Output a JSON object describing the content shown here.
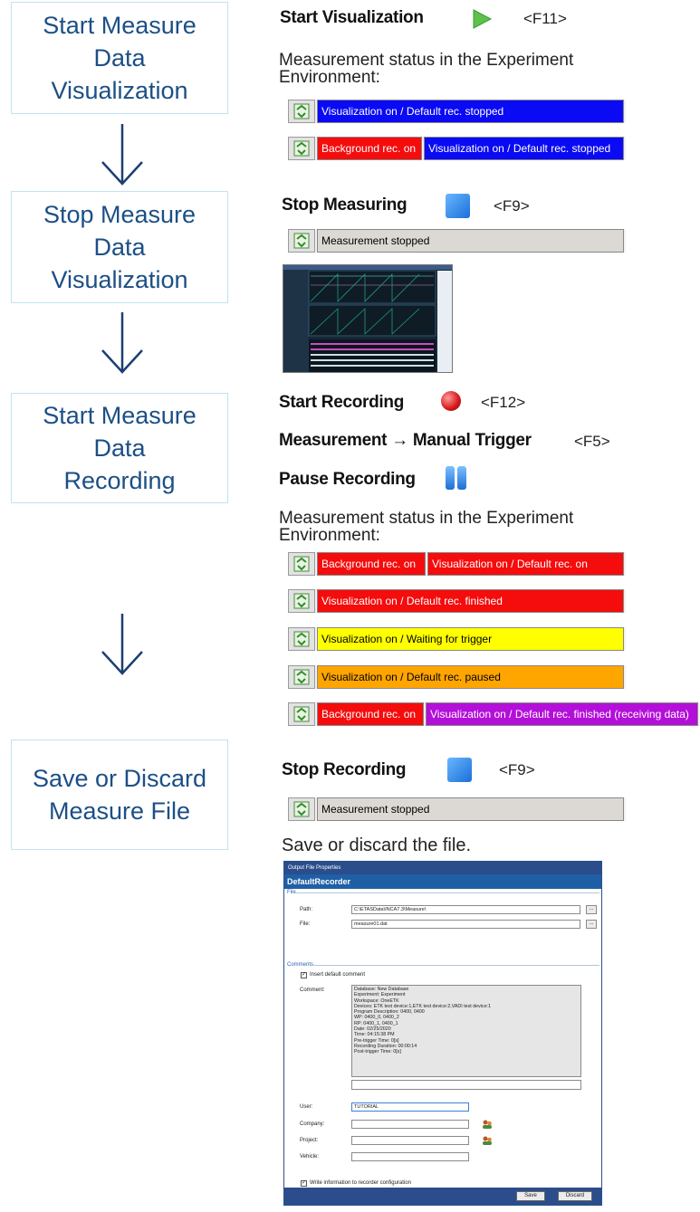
{
  "flow": {
    "steps": [
      {
        "label": "Start Measure\nData\nVisualization"
      },
      {
        "label": "Stop Measure\nData\nVisualization"
      },
      {
        "label": "Start Measure\nData\nRecording"
      },
      {
        "label": "Save or Discard\nMeasure File"
      }
    ]
  },
  "section1": {
    "heading": "Start Visualization",
    "shortcut": "<F11>",
    "status_intro": "Measurement status in the Experiment Environment:",
    "bar1": [
      "Visualization on / Default rec. stopped"
    ],
    "bar2": [
      "Background rec. on",
      "Visualization on / Default rec. stopped"
    ]
  },
  "section2": {
    "heading": "Stop Measuring",
    "shortcut": "<F9>",
    "bar": "Measurement stopped"
  },
  "section3": {
    "start_recording": "Start Recording",
    "start_shortcut": "<F12>",
    "manual_trigger": "Measurement → Manual Trigger",
    "trigger_shortcut": "<F5>",
    "pause_recording": "Pause Recording",
    "status_intro": "Measurement status in the Experiment Environment:",
    "bar1": [
      "Background rec. on",
      "Visualization on / Default rec. on"
    ],
    "bar2": [
      "Visualization on / Default rec. finished"
    ],
    "bar3": [
      "Visualization on / Waiting for trigger"
    ],
    "bar4": [
      "Visualization on / Default rec. paused"
    ],
    "bar5": [
      "Background rec. on",
      "Visualization on / Default rec. finished (receiving data)"
    ]
  },
  "section4": {
    "heading": "Stop Recording",
    "shortcut": "<F9>",
    "bar": "Measurement stopped",
    "save_text": "Save or discard the file."
  },
  "dialog": {
    "title": "Output File Properties",
    "recorder": "DefaultRecorder",
    "file_section": "File",
    "path_label": "Path:",
    "path_value": "C:\\ETASData\\INCA7.3\\Measure\\",
    "file_label": "File:",
    "file_value": "measure01.dat",
    "browse": "...",
    "comments_section": "Comments",
    "insert_default": "Insert default comment",
    "comment_label": "Comment:",
    "comment_lines": [
      "Database: New Database",
      "Experiment: Experiment",
      "Workspace: OneETK",
      "Devices: ETK test device:1,ETK test device:2,VADI test device:1",
      "Program Description: 0400, 0400",
      "WP: 0400_0, 0400_2",
      "RP: 0400_1, 0400_1",
      "Date: 02/25/2020",
      "Time: 04:15:38 PM",
      "Pre-trigger Time: 0[s]",
      "Recording Duration: 00:00:14",
      "Post-trigger Time: 0[s]"
    ],
    "user_label": "User:",
    "user_value": "TUTORIAL",
    "company_label": "Company:",
    "project_label": "Project:",
    "vehicle_label": "Vehicle:",
    "write_info": "Write information to recorder configuration",
    "save_button": "Save",
    "discard_button": "Discard"
  },
  "colors": {
    "box_border": "#bfe3f1",
    "box_text": "#1c4f86",
    "arrow": "#1c3f73",
    "blue": "#0a0af5",
    "red": "#f50c0c",
    "yellow": "#ffff00",
    "orange": "#ffa500",
    "purple": "#b30fd9"
  }
}
